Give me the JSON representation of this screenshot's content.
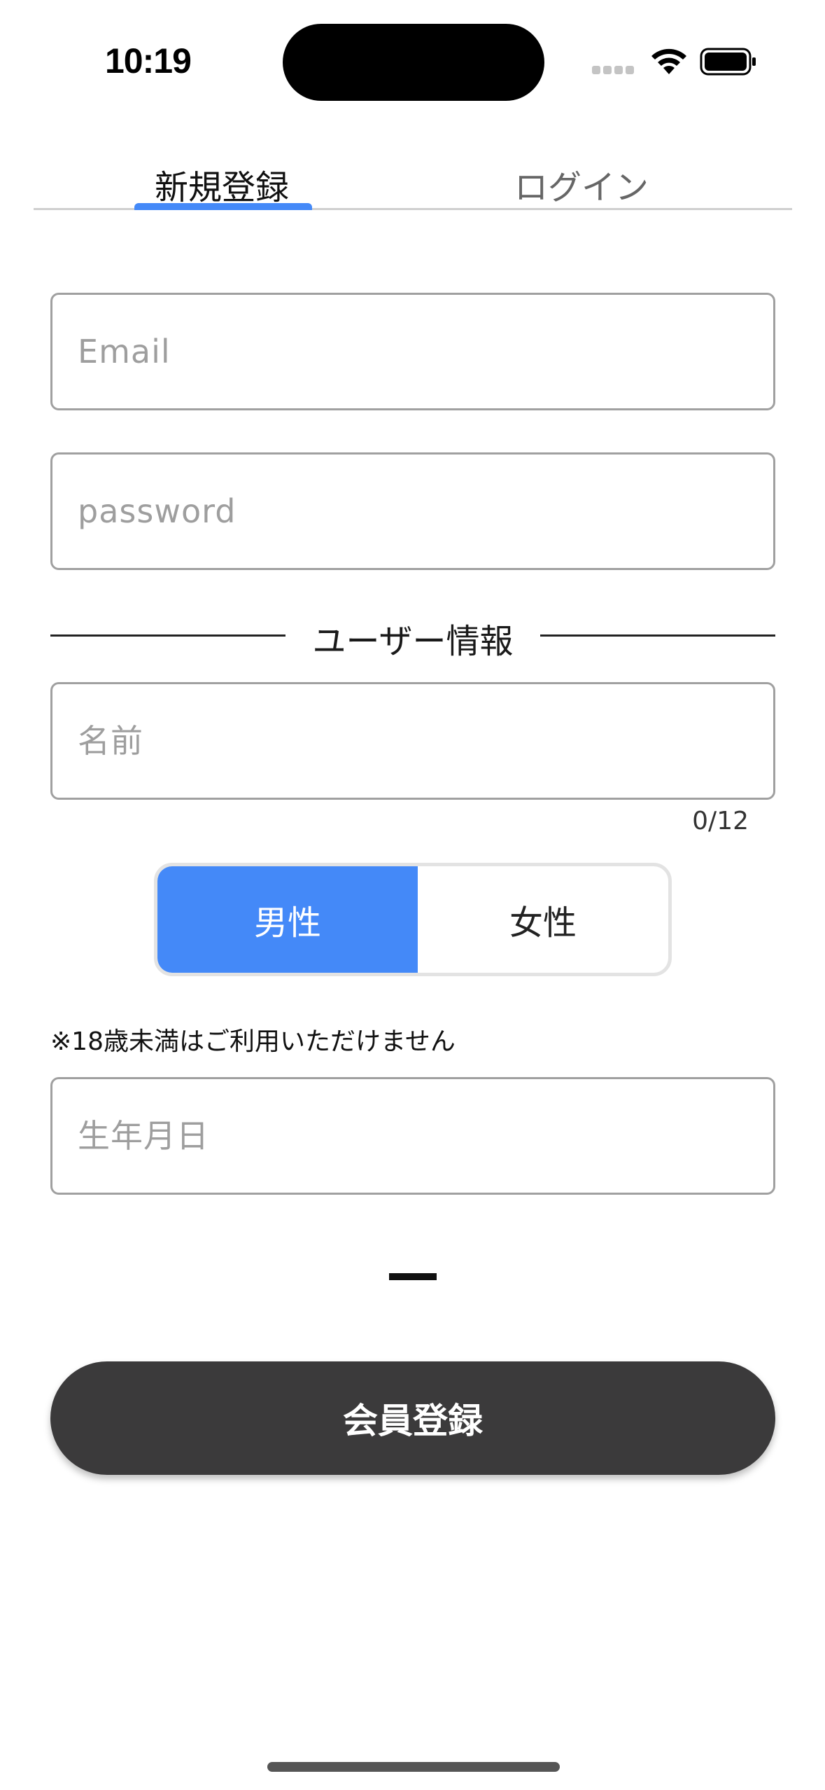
{
  "status_bar": {
    "time": "10:19",
    "icons": [
      "cellular-signal-icon",
      "wifi-icon",
      "battery-icon"
    ]
  },
  "tabs": [
    {
      "label": "新規登録",
      "selected": true
    },
    {
      "label": "ログイン",
      "selected": false
    }
  ],
  "form": {
    "email_placeholder": "Email",
    "password_placeholder": "password",
    "section_title": "ユーザー情報",
    "name_placeholder": "名前",
    "name_counter": "0/12",
    "gender_options": [
      {
        "label": "男性",
        "selected": true
      },
      {
        "label": "女性",
        "selected": false
      }
    ],
    "age_note": "※18歳未満はご利用いただけません",
    "birthdate_placeholder": "生年月日",
    "dash_text": "—",
    "submit_label": "会員登録"
  },
  "colors": {
    "accent": "#4489f8",
    "button_dark": "#3b3a3b",
    "border": "#a0a0a0"
  }
}
